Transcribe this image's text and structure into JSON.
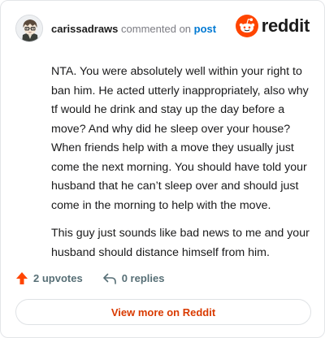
{
  "header": {
    "username": "carissadraws",
    "action_text": "commented on",
    "post_link": "post",
    "brand": "reddit",
    "accent_color": "#ff4500",
    "icons": [
      "avatar",
      "reddit-snoo-icon"
    ]
  },
  "comment": {
    "paragraphs": [
      "NTA. You were absolutely well within your right to ban him. He acted utterly inappropriately, also why tf would he drink and stay up the day before a move? And why did he sleep over your house? When friends help with a move they usually just come the next morning. You should have told your husband that he can’t sleep over and should just come in the morning to help with the move.",
      "This guy just sounds like bad news to me and your husband should distance himself from him."
    ]
  },
  "actions": {
    "upvotes": "2 upvotes",
    "replies": "0 replies",
    "icons": [
      "upvote-arrow-icon",
      "reply-icon"
    ]
  },
  "footer": {
    "view_more": "View more on Reddit"
  }
}
